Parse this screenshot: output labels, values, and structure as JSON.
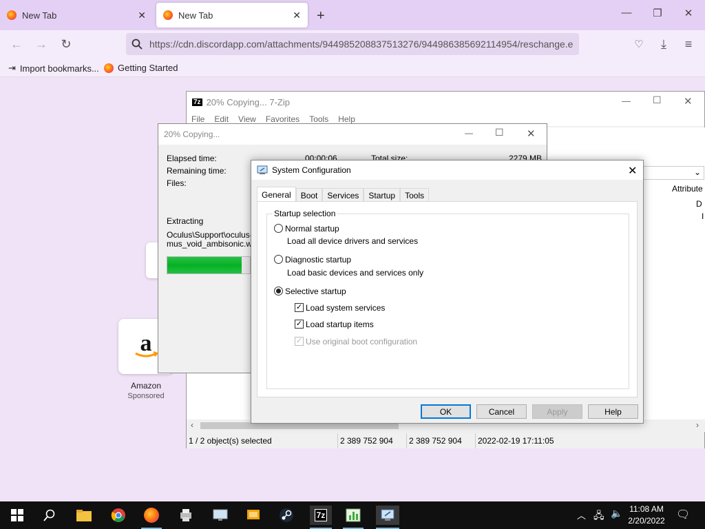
{
  "browser": {
    "tabs": [
      {
        "label": "New Tab"
      },
      {
        "label": "New Tab"
      }
    ],
    "new_tab_glyph": "+",
    "url": "https://cdn.discordapp.com/attachments/944985208837513276/944986385692114954/reschange.e",
    "bookmarks": [
      {
        "label": "Import bookmarks..."
      },
      {
        "label": "Getting Started"
      }
    ]
  },
  "newtab": {
    "amazon_label": "Amazon",
    "amazon_sponsored": "Sponsored",
    "amazon_logo": "a"
  },
  "zip": {
    "title": "20% Copying... 7-Zip",
    "menu": [
      "File",
      "Edit",
      "View",
      "Favorites",
      "Tools",
      "Help"
    ],
    "attributes_header": "Attribute",
    "attr_values": [
      "D",
      "I"
    ],
    "status": [
      "1 / 2 object(s) selected",
      "2 389 752 904",
      "2 389 752 904",
      "2022-02-19 17:11:05"
    ]
  },
  "copy": {
    "title": "20% Copying...",
    "elapsed_label": "Elapsed time:",
    "elapsed_value": "00:00:06",
    "total_label": "Total size:",
    "total_value": "2279 MB",
    "remaining_label": "Remaining time:",
    "files_label": "Files:",
    "extracting_label": "Extracting",
    "file_line1": "Oculus\\Support\\oculus-da",
    "file_line2": "mus_void_ambisonic.wav",
    "progress": 0.2
  },
  "msconfig": {
    "title": "System Configuration",
    "tabs": [
      "General",
      "Boot",
      "Services",
      "Startup",
      "Tools"
    ],
    "group_label": "Startup selection",
    "normal": {
      "label": "Normal startup",
      "desc": "Load all device drivers and services"
    },
    "diagnostic": {
      "label": "Diagnostic startup",
      "desc": "Load basic devices and services only"
    },
    "selective": {
      "label": "Selective startup"
    },
    "checks": {
      "system_services": "Load system services",
      "startup_items": "Load startup items",
      "original_boot": "Use original boot configuration"
    },
    "buttons": {
      "ok": "OK",
      "cancel": "Cancel",
      "apply": "Apply",
      "help": "Help"
    }
  },
  "taskbar": {
    "time": "11:08 AM",
    "date": "2/20/2022",
    "zip_label": "7z"
  }
}
